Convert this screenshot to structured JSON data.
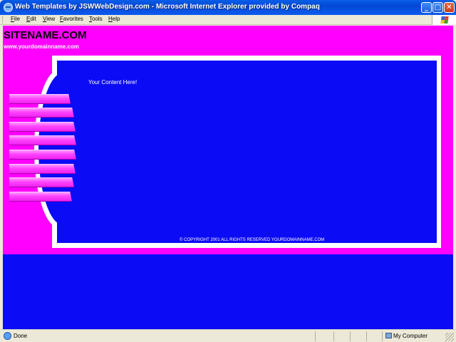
{
  "window": {
    "title": "Web Templates by JSWWebDesign.com - Microsoft Internet Explorer provided by Compaq",
    "buttons": {
      "minimize": "_",
      "maximize": "□",
      "close": "✕"
    }
  },
  "menu": {
    "items": [
      "File",
      "Edit",
      "View",
      "Favorites",
      "Tools",
      "Help"
    ]
  },
  "page": {
    "sitename": "SITENAME.COM",
    "domain": "www.yourdomainname.com",
    "content": "Your Content Here!",
    "copyright": "© COPYRIGHT 2001 ALL RIGHTS RESERVED YOURDOMAINNAME.COM",
    "nav_button_count": 8,
    "colors": {
      "magenta": "#ff00ff",
      "blue": "#0b0bf5",
      "nav_pink": "#ff44ff",
      "white": "#ffffff"
    }
  },
  "status": {
    "text": "Done",
    "zone": "My Computer"
  }
}
